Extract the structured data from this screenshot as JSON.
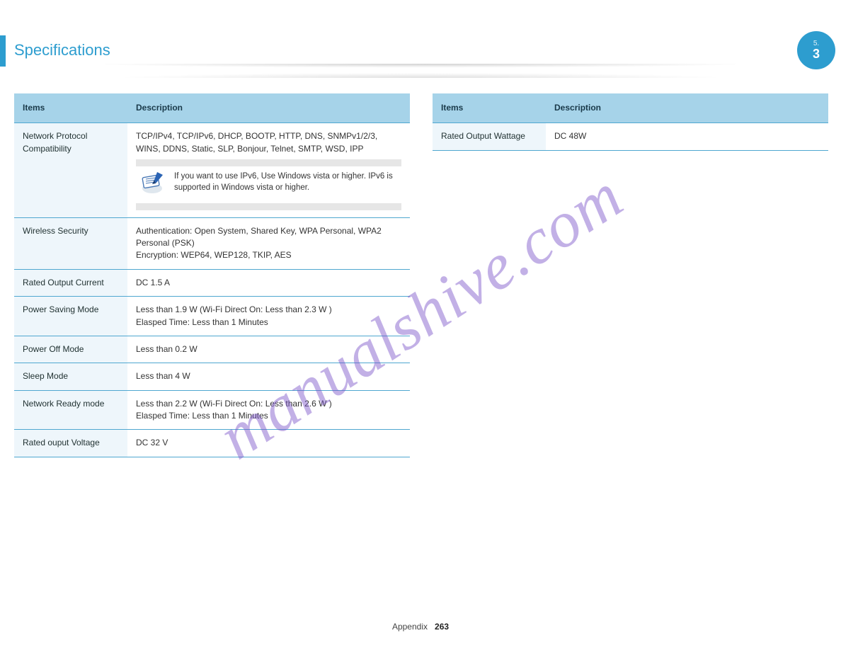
{
  "header": {
    "title": "Specifications",
    "badge_section": "5.",
    "badge_page": "3"
  },
  "watermark": "manualshive.com",
  "table_left": {
    "head_items": "Items",
    "head_desc": "Description",
    "rows": [
      {
        "key": "Network Protocol Compatibility",
        "val_main": "TCP/IPv4, TCP/IPv6, DHCP, BOOTP, HTTP, DNS, SNMPv1/2/3, WINS, DDNS, Static, SLP, Bonjour, Telnet, SMTP, WSD, IPP",
        "note": "If you want to use IPv6, Use Windows vista or higher. IPv6 is supported in Windows vista or higher."
      },
      {
        "key": "Wireless Security",
        "val_main": "Authentication: Open System, Shared Key, WPA Personal, WPA2 Personal (PSK)\nEncryption: WEP64, WEP128, TKIP, AES"
      },
      {
        "key": "Rated Output Current",
        "val_main": "DC 1.5 A"
      },
      {
        "key": "Power Saving Mode",
        "val_main": "Less than 1.9 W (Wi-Fi Direct On: Less than 2.3 W )\nElasped Time: Less than 1 Minutes"
      },
      {
        "key": "Power Off Mode",
        "val_main": "Less than 0.2 W"
      },
      {
        "key": "Sleep Mode",
        "val_main": "Less than 4 W"
      },
      {
        "key": "Network Ready mode",
        "val_main": "Less than 2.2 W (Wi-Fi Direct On: Less than 2.6 W )\nElasped Time: Less than 1 Minutes"
      },
      {
        "key": "Rated ouput Voltage",
        "val_main": "DC 32 V"
      }
    ]
  },
  "table_right": {
    "head_items": "Items",
    "head_desc": "Description",
    "rows": [
      {
        "key": "Rated Output Wattage",
        "val_main": "DC 48W"
      }
    ]
  },
  "footer": {
    "section": "Appendix",
    "page": "263"
  }
}
